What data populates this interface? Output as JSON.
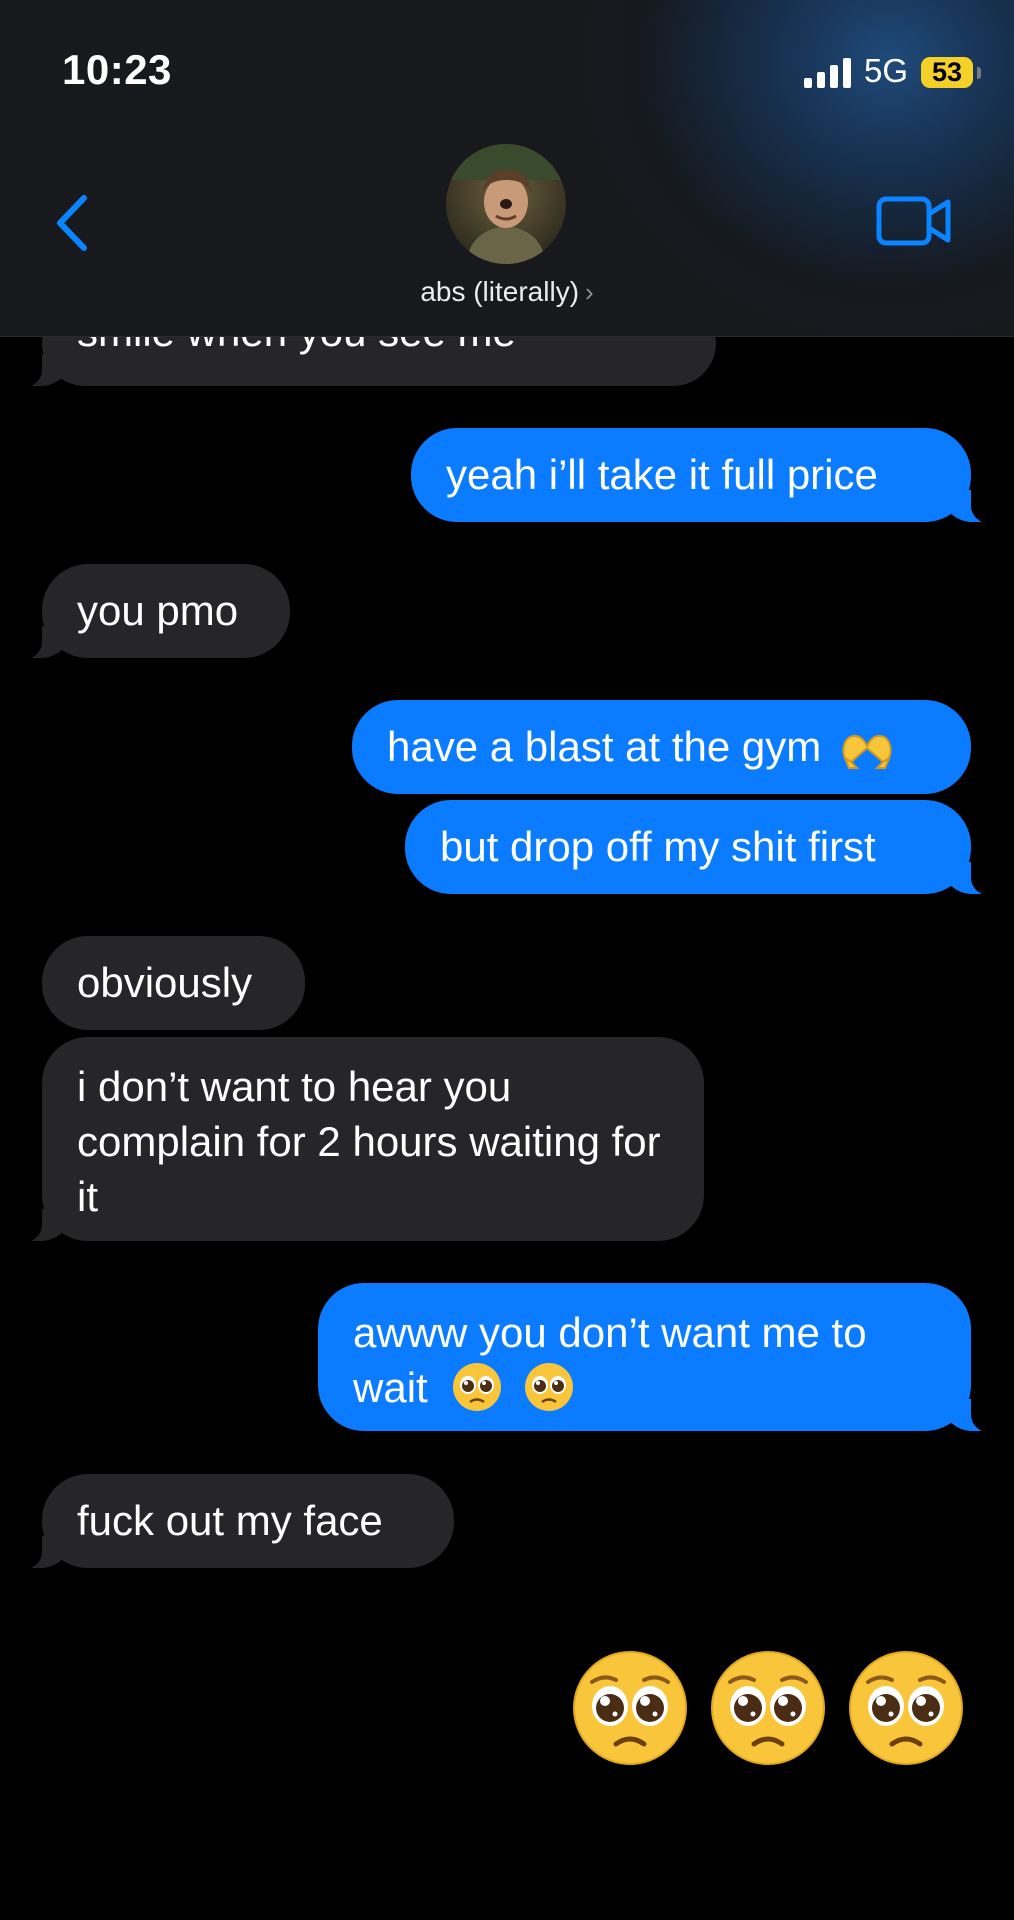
{
  "status_bar": {
    "time": "10:23",
    "network": "5G",
    "battery": "53"
  },
  "header": {
    "contact_name": "abs (literally)",
    "chevron": "›",
    "back_icon": "chevron-left-icon",
    "video_icon": "video-camera-icon"
  },
  "colors": {
    "incoming_bubble": "#262628",
    "outgoing_bubble": "#0b7cff",
    "accent": "#0a84ff",
    "battery": "#f5d028"
  },
  "messages": [
    {
      "direction": "incoming",
      "text": "smile when you see me"
    },
    {
      "direction": "outgoing",
      "text": "yeah i’ll take it full price"
    },
    {
      "direction": "incoming",
      "text": "you pmo"
    },
    {
      "direction": "outgoing",
      "text": "have a blast at the gym",
      "emoji": "heart-hands-emoji"
    },
    {
      "direction": "outgoing",
      "text": "but drop off my shit first"
    },
    {
      "direction": "incoming",
      "text": "obviously"
    },
    {
      "direction": "incoming",
      "text": "i don’t want to hear you complain for 2 hours waiting for it"
    },
    {
      "direction": "outgoing",
      "text": "awww you don’t want me to wait",
      "emoji": "pleading-face-emoji x2"
    },
    {
      "direction": "incoming",
      "text": "fuck out my face"
    },
    {
      "direction": "outgoing",
      "emoji": "pleading-face-emoji x3"
    }
  ]
}
